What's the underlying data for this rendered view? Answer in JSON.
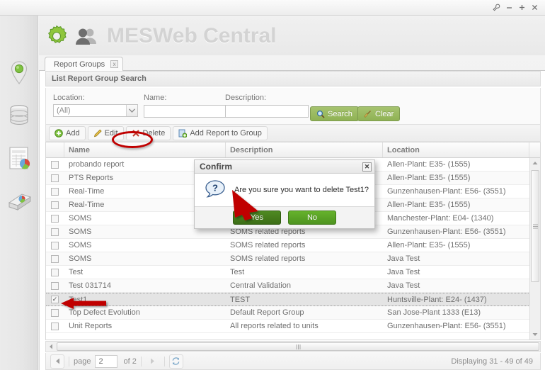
{
  "window": {
    "controls": [
      {
        "name": "wrench-icon",
        "glyph": "wrench"
      },
      {
        "name": "minimize-icon",
        "glyph": "minus"
      },
      {
        "name": "maximize-icon",
        "glyph": "plus"
      },
      {
        "name": "close-icon",
        "glyph": "x"
      }
    ]
  },
  "banner": {
    "title": "MESWeb Central",
    "gear_icon": "gear-icon",
    "users_icon": "users-icon"
  },
  "rail": {
    "items": [
      {
        "icon": "location-pin-icon",
        "label": "Locations"
      },
      {
        "icon": "database-icon",
        "label": "Data"
      },
      {
        "icon": "report-chart-icon",
        "label": "Reports"
      },
      {
        "icon": "report-stack-icon",
        "label": "Report Groups"
      }
    ]
  },
  "tab": {
    "label": "Report Groups",
    "close_glyph": "x"
  },
  "panel": {
    "header": "List Report Group Search"
  },
  "search": {
    "location_label": "Location:",
    "location_value": "(All)",
    "name_label": "Name:",
    "name_value": "",
    "name_placeholder": "",
    "description_label": "Description:",
    "description_value": "",
    "description_placeholder": "",
    "search_button": "Search",
    "search_icon": "magnifier-icon",
    "clear_button": "Clear",
    "clear_icon": "broom-icon"
  },
  "toolbar": {
    "buttons": [
      {
        "label": "Add",
        "icon": "plus-circle-icon"
      },
      {
        "label": "Edit",
        "icon": "pencil-icon"
      },
      {
        "label": "Delete",
        "icon": "delete-x-icon"
      },
      {
        "label": "Add Report to Group",
        "icon": "add-report-icon"
      }
    ]
  },
  "grid": {
    "columns": [
      "",
      "Name",
      "Description",
      "Location"
    ],
    "rows": [
      {
        "checked": false,
        "name": "probando report",
        "description": "",
        "location": "Allen-Plant: E35- (1555)"
      },
      {
        "checked": false,
        "name": "PTS Reports",
        "description": "",
        "location": "Allen-Plant: E35- (1555)"
      },
      {
        "checked": false,
        "name": "Real-Time",
        "description": "",
        "location": "Gunzenhausen-Plant: E56- (3551)"
      },
      {
        "checked": false,
        "name": "Real-Time",
        "description": "",
        "location": "Allen-Plant: E35- (1555)"
      },
      {
        "checked": false,
        "name": "SOMS",
        "description": "",
        "location": "Manchester-Plant: E04- (1340)"
      },
      {
        "checked": false,
        "name": "SOMS",
        "description": "SOMS related reports",
        "location": "Gunzenhausen-Plant: E56- (3551)"
      },
      {
        "checked": false,
        "name": "SOMS",
        "description": "SOMS related reports",
        "location": "Allen-Plant: E35- (1555)"
      },
      {
        "checked": false,
        "name": "SOMS",
        "description": "SOMS related reports",
        "location": "Java Test"
      },
      {
        "checked": false,
        "name": "Test",
        "description": "Test",
        "location": "Java Test"
      },
      {
        "checked": false,
        "name": "Test 031714",
        "description": "Central Validation",
        "location": "Java Test"
      },
      {
        "checked": true,
        "name": "Test1",
        "description": "TEST",
        "location": "Huntsville-Plant: E24- (1437)"
      },
      {
        "checked": false,
        "name": "Top Defect Evolution",
        "description": "Default Report Group",
        "location": "San Jose-Plant 1333 (E13)"
      },
      {
        "checked": false,
        "name": "Unit Reports",
        "description": "All reports related to units",
        "location": "Gunzenhausen-Plant: E56- (3551)"
      }
    ]
  },
  "pager": {
    "prev_glyph": "◀",
    "next_glyph": "▶",
    "page_label": "page",
    "page_value": "2",
    "of_label": "of 2",
    "refresh_icon": "refresh-icon",
    "status": "Displaying 31 - 49 of 49"
  },
  "dialog": {
    "title": "Confirm",
    "close_glyph": "✕",
    "icon": "question-mark-icon",
    "message": "Are you sure you want to delete Test1?",
    "yes_label": "Yes",
    "no_label": "No"
  },
  "annotations": {
    "highlight_color": "#c00000",
    "circled_target": "Delete",
    "arrow_to_yes": "Yes",
    "arrow_to_selected_row": "Test1"
  }
}
